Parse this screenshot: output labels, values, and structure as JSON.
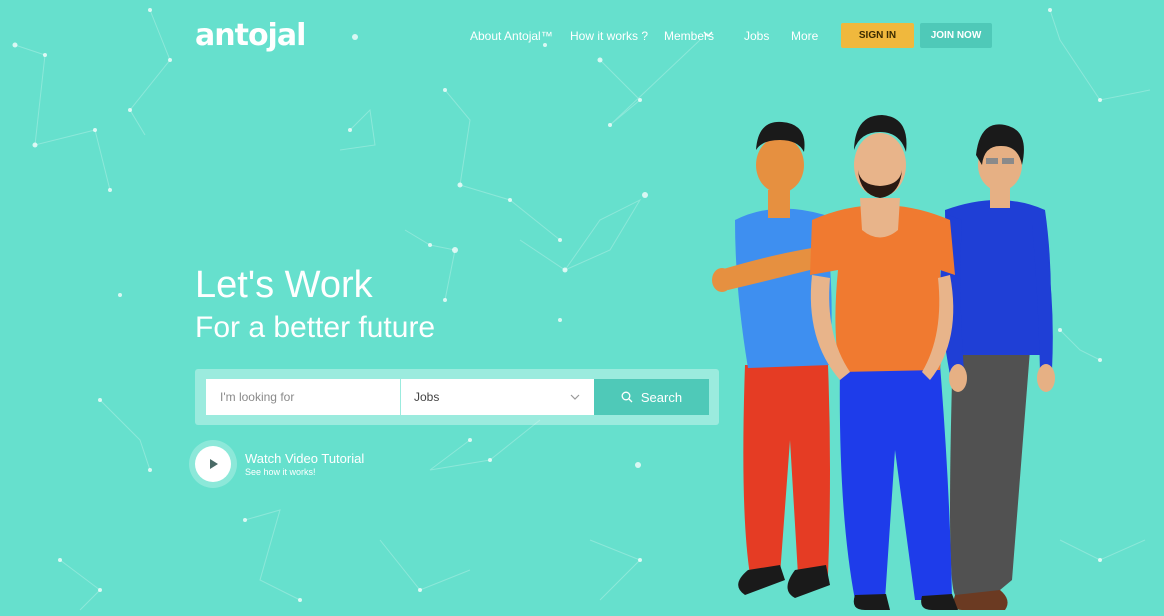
{
  "brand": {
    "logo_text": "antojal"
  },
  "nav": {
    "items": [
      "About Antojal™",
      "How it works ?",
      "Members",
      "Jobs",
      "More"
    ],
    "signin_label": "SIGN IN",
    "join_label": "JOIN NOW"
  },
  "hero": {
    "title": "Let's Work",
    "subtitle": "For a better future"
  },
  "search": {
    "placeholder": "I'm looking for",
    "category_value": "Jobs",
    "button_label": "Search"
  },
  "video": {
    "title": "Watch Video Tutorial",
    "subtitle": "See how it works!"
  },
  "colors": {
    "background": "#66e0cd",
    "accent_teal": "#4fc9b8",
    "signin_yellow": "#f0b83d"
  },
  "icons": [
    "chevron-down-icon",
    "search-icon",
    "play-icon"
  ]
}
